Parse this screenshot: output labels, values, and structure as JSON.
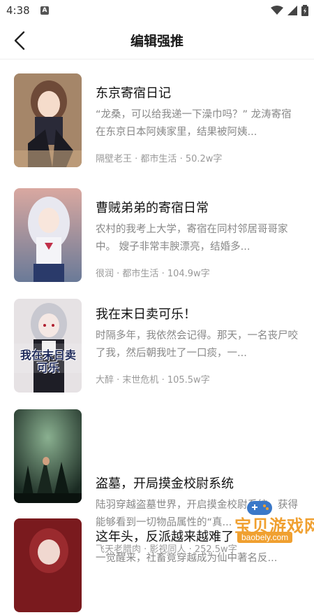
{
  "status_bar": {
    "time": "4:38",
    "notification_icon": "A"
  },
  "header": {
    "title": "编辑强推",
    "back_icon": "chevron-left"
  },
  "books": [
    {
      "title": "东京寄宿日记",
      "description": "“龙桑，可以给我递一下澡巾吗？” 龙涛寄宿在东京日本阿姨家里，结果被阿姨...",
      "author": "隔壁老王",
      "category": "都市生活",
      "words": "50.2w字"
    },
    {
      "title": "曹贼弟弟的寄宿日常",
      "description": "农村的我考上大学，寄宿在同村邻居哥哥家中。 嫂子非常丰腴漂亮，结婚多...",
      "author": "很润",
      "category": "都市生活",
      "words": "104.9w字"
    },
    {
      "title": "我在末日卖可乐！",
      "description": "时隔多年，我依然会记得。那天，一名丧尸咬了我，然后朝我吐了一口痰，一...",
      "author": "大醉",
      "category": "末世危机",
      "words": "105.5w字",
      "cover_text": "我在末日卖可乐"
    },
    {
      "title": "盗墓，开局摸金校尉系统",
      "description": "陆羽穿越盗墓世界，开启摸金校尉系统，获得能够看到一切物品属性的“真...",
      "author": "飞天老腊肉",
      "category": "影视同人",
      "words": "252.5w字"
    },
    {
      "title": "这年头，反派越来越难了",
      "description": "一觉醒来，社畜竟穿越成为仙中著名反...",
      "author": "",
      "category": "",
      "words": ""
    }
  ],
  "watermark": {
    "text": "宝贝游戏网",
    "url": "baobely.com"
  }
}
